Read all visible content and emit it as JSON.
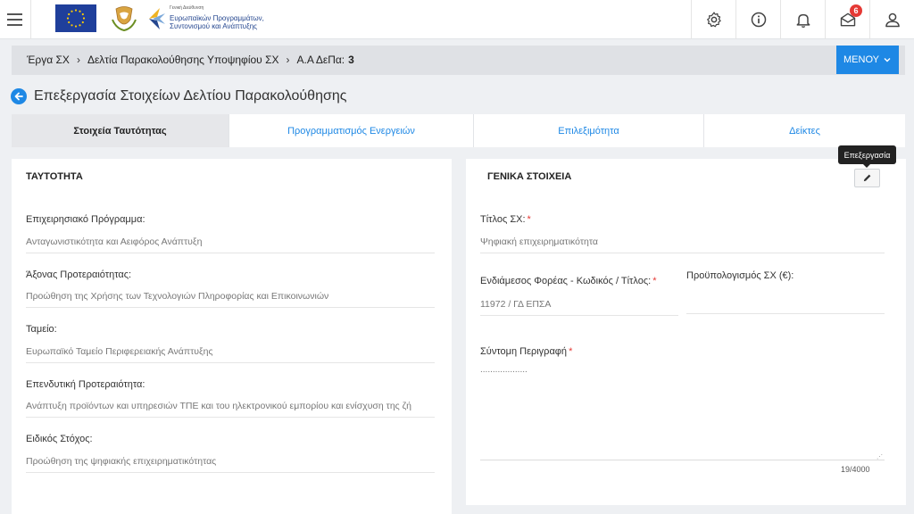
{
  "topbar": {
    "logo_text": [
      "Γενική Διεύθυνση",
      "Ευρωπαϊκών Προγραμμάτων,",
      "Συντονισμού και Ανάπτυξης"
    ],
    "icons": [
      "gear-icon",
      "info-icon",
      "bell-icon",
      "mail-icon",
      "user-icon"
    ],
    "mail_badge": "6"
  },
  "breadcrumb": {
    "items": [
      "Έργα ΣΧ",
      "Δελτία Παρακολούθησης Υποψηφίου ΣΧ",
      "Α.Α ΔεΠα:"
    ],
    "id_value": "3",
    "menu_label": "ΜΕΝΟΥ"
  },
  "page": {
    "title": "Επεξεργασία Στοιχείων Δελτίου Παρακολούθησης"
  },
  "tabs": [
    {
      "label": "Στοιχεία Ταυτότητας",
      "active": true
    },
    {
      "label": "Προγραμματισμός Ενεργειών",
      "active": false
    },
    {
      "label": "Επιλεξιμότητα",
      "active": false
    },
    {
      "label": "Δείκτες",
      "active": false
    }
  ],
  "left_panel": {
    "title": "ΤΑΥΤΟΤΗΤΑ",
    "fields": [
      {
        "label": "Επιχειρησιακό Πρόγραμμα:",
        "value": "Ανταγωνιστικότητα και Αειφόρος Ανάπτυξη"
      },
      {
        "label": "Άξονας Προτεραιότητας:",
        "value": "Προώθηση της Χρήσης των Τεχνολογιών Πληροφορίας και Επικοινωνιών"
      },
      {
        "label": "Ταμείο:",
        "value": "Ευρωπαϊκό Ταμείο Περιφερειακής Ανάπτυξης"
      },
      {
        "label": "Επενδυτική Προτεραιότητα:",
        "value": "Ανάπτυξη προϊόντων και υπηρεσιών ΤΠΕ και του ηλεκτρονικού εμπορίου και ενίσχυση της ζή"
      },
      {
        "label": "Ειδικός Στόχος:",
        "value": "Προώθηση της ψηφιακής επιχειρηματικότητας"
      }
    ]
  },
  "right_panel": {
    "title": "ΓΕΝΙΚΑ ΣΤΟΙΧΕΙΑ",
    "edit_tooltip": "Επεξεργασία",
    "title_label": "Τίτλος ΣΧ:",
    "title_value": "Ψηφιακή επιχειρηματικότητα",
    "body_label": "Ενδιάμεσος Φορέας - Κωδικός / Τίτλος:",
    "body_value": "11972 / ΓΔ ΕΠΣΑ",
    "budget_label": "Προϋπολογισμός ΣΧ (€):",
    "budget_value": "",
    "desc_label": "Σύντομη Περιγραφή",
    "desc_value": "...................",
    "desc_counter": "19/4000",
    "required_mark": "*"
  }
}
